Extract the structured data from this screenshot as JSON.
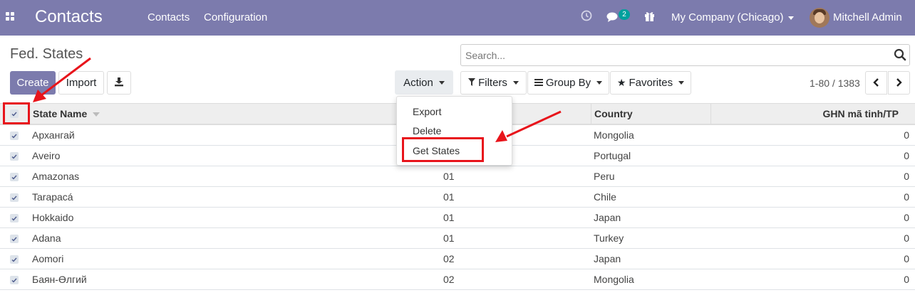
{
  "app": {
    "title": "Contacts",
    "menu": [
      "Contacts",
      "Configuration"
    ]
  },
  "systray": {
    "messages_count": "2",
    "company": "My Company (Chicago)",
    "user": "Mitchell Admin"
  },
  "breadcrumb": "Fed. States",
  "search": {
    "placeholder": "Search..."
  },
  "buttons": {
    "create": "Create",
    "import": "Import",
    "action": "Action",
    "filters": "Filters",
    "group_by": "Group By",
    "favorites": "Favorites"
  },
  "pager": {
    "value": "1-80 / 1383"
  },
  "table": {
    "columns": [
      "State Name",
      "Country",
      "GHN mã tinh/TP"
    ],
    "rows": [
      {
        "name": "Архангай",
        "code": "",
        "country": "Mongolia",
        "ghn": "0"
      },
      {
        "name": "Aveiro",
        "code": "",
        "country": "Portugal",
        "ghn": "0"
      },
      {
        "name": "Amazonas",
        "code": "01",
        "country": "Peru",
        "ghn": "0"
      },
      {
        "name": "Tarapacá",
        "code": "01",
        "country": "Chile",
        "ghn": "0"
      },
      {
        "name": "Hokkaido",
        "code": "01",
        "country": "Japan",
        "ghn": "0"
      },
      {
        "name": "Adana",
        "code": "01",
        "country": "Turkey",
        "ghn": "0"
      },
      {
        "name": "Aomori",
        "code": "02",
        "country": "Japan",
        "ghn": "0"
      },
      {
        "name": "Баян-Өлгий",
        "code": "02",
        "country": "Mongolia",
        "ghn": "0"
      }
    ]
  },
  "action_menu": {
    "items": [
      "Export",
      "Delete",
      "Get States"
    ]
  },
  "colors": {
    "brand": "#7c7bad",
    "highlight": "#e8141b",
    "badge": "#00a09d"
  }
}
